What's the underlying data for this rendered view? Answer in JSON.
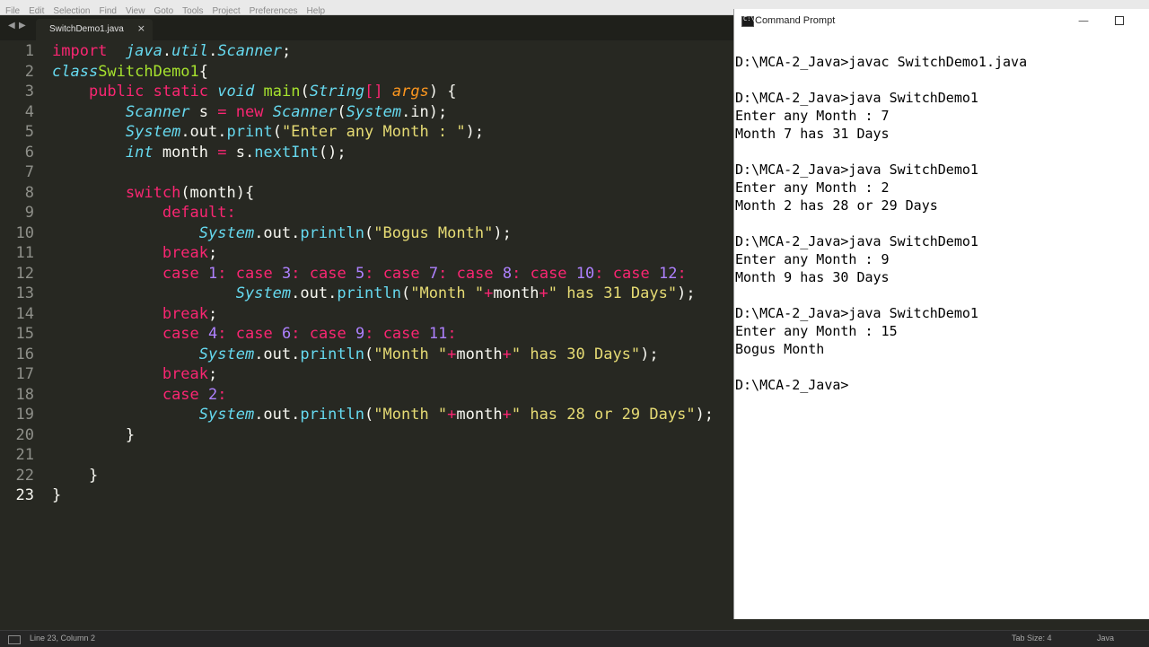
{
  "menu": [
    "File",
    "Edit",
    "Selection",
    "Find",
    "View",
    "Goto",
    "Tools",
    "Project",
    "Preferences",
    "Help"
  ],
  "tab": {
    "title": "SwitchDemo1.java",
    "close": "×"
  },
  "nav": {
    "back": "◀",
    "forward": "▶"
  },
  "editor": {
    "line_numbers": [
      "1",
      "2",
      "3",
      "4",
      "5",
      "6",
      "7",
      "8",
      "9",
      "10",
      "11",
      "12",
      "13",
      "14",
      "15",
      "16",
      "17",
      "18",
      "19",
      "20",
      "21",
      "22",
      "23"
    ],
    "current_line": "23",
    "lines": [
      {
        "n": "1",
        "tokens": [
          [
            "kw",
            "import"
          ],
          [
            "",
            "  "
          ],
          [
            "ty",
            "java"
          ],
          [
            "",
            "."
          ],
          [
            "ty",
            "util"
          ],
          [
            "",
            "."
          ],
          [
            "ty",
            "Scanner"
          ],
          [
            "",
            ";"
          ]
        ]
      },
      {
        "n": "2",
        "tokens": [
          [
            "ty",
            "class"
          ],
          [
            "",
            ""
          ],
          [
            "fn",
            "SwitchDemo1"
          ],
          [
            "",
            "{"
          ]
        ]
      },
      {
        "n": "3",
        "tokens": [
          [
            "",
            "    "
          ],
          [
            "kw",
            "public"
          ],
          [
            "",
            " "
          ],
          [
            "kw",
            "static"
          ],
          [
            "",
            " "
          ],
          [
            "ty",
            "void"
          ],
          [
            "",
            " "
          ],
          [
            "fn",
            "main"
          ],
          [
            "",
            "("
          ],
          [
            "ty",
            "String"
          ],
          [
            "kw",
            "[]"
          ],
          [
            "",
            " "
          ],
          [
            "ar",
            "args"
          ],
          [
            "",
            ") {"
          ]
        ]
      },
      {
        "n": "4",
        "tokens": [
          [
            "",
            "        "
          ],
          [
            "ty",
            "Scanner"
          ],
          [
            "",
            " s "
          ],
          [
            "kw",
            "="
          ],
          [
            "",
            " "
          ],
          [
            "kw",
            "new"
          ],
          [
            "",
            " "
          ],
          [
            "ty",
            "Scanner"
          ],
          [
            "",
            "("
          ],
          [
            "ty",
            "System"
          ],
          [
            "",
            ".in);"
          ]
        ]
      },
      {
        "n": "5",
        "tokens": [
          [
            "",
            "        "
          ],
          [
            "ty",
            "System"
          ],
          [
            "",
            ".out."
          ],
          [
            "cn",
            "print"
          ],
          [
            "",
            "("
          ],
          [
            "st",
            "\"Enter any Month : \""
          ],
          [
            "",
            ");"
          ]
        ]
      },
      {
        "n": "6",
        "tokens": [
          [
            "",
            "        "
          ],
          [
            "ty",
            "int"
          ],
          [
            "",
            " month "
          ],
          [
            "kw",
            "="
          ],
          [
            "",
            " s."
          ],
          [
            "cn",
            "nextInt"
          ],
          [
            "",
            "();"
          ]
        ]
      },
      {
        "n": "7",
        "tokens": []
      },
      {
        "n": "8",
        "tokens": [
          [
            "",
            "        "
          ],
          [
            "kw",
            "switch"
          ],
          [
            "",
            "(month){"
          ]
        ]
      },
      {
        "n": "9",
        "tokens": [
          [
            "",
            "            "
          ],
          [
            "kw",
            "default:"
          ]
        ]
      },
      {
        "n": "10",
        "tokens": [
          [
            "",
            "                "
          ],
          [
            "ty",
            "System"
          ],
          [
            "",
            ".out."
          ],
          [
            "cn",
            "println"
          ],
          [
            "",
            "("
          ],
          [
            "st",
            "\"Bogus Month\""
          ],
          [
            "",
            ");"
          ]
        ]
      },
      {
        "n": "11",
        "tokens": [
          [
            "",
            "            "
          ],
          [
            "kw",
            "break"
          ],
          [
            "",
            ";"
          ]
        ]
      },
      {
        "n": "12",
        "tokens": [
          [
            "",
            "            "
          ],
          [
            "kw",
            "case"
          ],
          [
            "",
            " "
          ],
          [
            "nu",
            "1"
          ],
          [
            "kw",
            ":"
          ],
          [
            "",
            " "
          ],
          [
            "kw",
            "case"
          ],
          [
            "",
            " "
          ],
          [
            "nu",
            "3"
          ],
          [
            "kw",
            ":"
          ],
          [
            "",
            " "
          ],
          [
            "kw",
            "case"
          ],
          [
            "",
            " "
          ],
          [
            "nu",
            "5"
          ],
          [
            "kw",
            ":"
          ],
          [
            "",
            " "
          ],
          [
            "kw",
            "case"
          ],
          [
            "",
            " "
          ],
          [
            "nu",
            "7"
          ],
          [
            "kw",
            ":"
          ],
          [
            "",
            " "
          ],
          [
            "kw",
            "case"
          ],
          [
            "",
            " "
          ],
          [
            "nu",
            "8"
          ],
          [
            "kw",
            ":"
          ],
          [
            "",
            " "
          ],
          [
            "kw",
            "case"
          ],
          [
            "",
            " "
          ],
          [
            "nu",
            "10"
          ],
          [
            "kw",
            ":"
          ],
          [
            "",
            " "
          ],
          [
            "kw",
            "case"
          ],
          [
            "",
            " "
          ],
          [
            "nu",
            "12"
          ],
          [
            "kw",
            ":"
          ]
        ]
      },
      {
        "n": "13",
        "tokens": [
          [
            "",
            "                    "
          ],
          [
            "ty",
            "System"
          ],
          [
            "",
            ".out."
          ],
          [
            "cn",
            "println"
          ],
          [
            "",
            "("
          ],
          [
            "st",
            "\"Month \""
          ],
          [
            "kw",
            "+"
          ],
          [
            "",
            "month"
          ],
          [
            "kw",
            "+"
          ],
          [
            "st",
            "\" has 31 Days\""
          ],
          [
            "",
            ");"
          ]
        ]
      },
      {
        "n": "14",
        "tokens": [
          [
            "",
            "            "
          ],
          [
            "kw",
            "break"
          ],
          [
            "",
            ";"
          ]
        ]
      },
      {
        "n": "15",
        "tokens": [
          [
            "",
            "            "
          ],
          [
            "kw",
            "case"
          ],
          [
            "",
            " "
          ],
          [
            "nu",
            "4"
          ],
          [
            "kw",
            ":"
          ],
          [
            "",
            " "
          ],
          [
            "kw",
            "case"
          ],
          [
            "",
            " "
          ],
          [
            "nu",
            "6"
          ],
          [
            "kw",
            ":"
          ],
          [
            "",
            " "
          ],
          [
            "kw",
            "case"
          ],
          [
            "",
            " "
          ],
          [
            "nu",
            "9"
          ],
          [
            "kw",
            ":"
          ],
          [
            "",
            " "
          ],
          [
            "kw",
            "case"
          ],
          [
            "",
            " "
          ],
          [
            "nu",
            "11"
          ],
          [
            "kw",
            ":"
          ]
        ]
      },
      {
        "n": "16",
        "tokens": [
          [
            "",
            "                "
          ],
          [
            "ty",
            "System"
          ],
          [
            "",
            ".out."
          ],
          [
            "cn",
            "println"
          ],
          [
            "",
            "("
          ],
          [
            "st",
            "\"Month \""
          ],
          [
            "kw",
            "+"
          ],
          [
            "",
            "month"
          ],
          [
            "kw",
            "+"
          ],
          [
            "st",
            "\" has 30 Days\""
          ],
          [
            "",
            ");"
          ]
        ]
      },
      {
        "n": "17",
        "tokens": [
          [
            "",
            "            "
          ],
          [
            "kw",
            "break"
          ],
          [
            "",
            ";"
          ]
        ]
      },
      {
        "n": "18",
        "tokens": [
          [
            "",
            "            "
          ],
          [
            "kw",
            "case"
          ],
          [
            "",
            " "
          ],
          [
            "nu",
            "2"
          ],
          [
            "kw",
            ":"
          ]
        ]
      },
      {
        "n": "19",
        "tokens": [
          [
            "",
            "                "
          ],
          [
            "ty",
            "System"
          ],
          [
            "",
            ".out."
          ],
          [
            "cn",
            "println"
          ],
          [
            "",
            "("
          ],
          [
            "st",
            "\"Month \""
          ],
          [
            "kw",
            "+"
          ],
          [
            "",
            "month"
          ],
          [
            "kw",
            "+"
          ],
          [
            "st",
            "\" has 28 or 29 Days\""
          ],
          [
            "",
            ");"
          ]
        ]
      },
      {
        "n": "20",
        "tokens": [
          [
            "",
            "        }"
          ]
        ]
      },
      {
        "n": "21",
        "tokens": []
      },
      {
        "n": "22",
        "tokens": [
          [
            "",
            "    }"
          ]
        ]
      },
      {
        "n": "23",
        "tokens": [
          [
            "",
            "}"
          ]
        ]
      }
    ]
  },
  "statusbar": {
    "position": "Line 23, Column 2",
    "tab_size": "Tab Size: 4",
    "syntax": "Java"
  },
  "cmd": {
    "title": "Command Prompt",
    "icon_glyph": "C:\\",
    "minimize": "—",
    "lines": [
      "",
      "D:\\MCA-2_Java>javac SwitchDemo1.java",
      "",
      "D:\\MCA-2_Java>java SwitchDemo1",
      "Enter any Month : 7",
      "Month 7 has 31 Days",
      "",
      "D:\\MCA-2_Java>java SwitchDemo1",
      "Enter any Month : 2",
      "Month 2 has 28 or 29 Days",
      "",
      "D:\\MCA-2_Java>java SwitchDemo1",
      "Enter any Month : 9",
      "Month 9 has 30 Days",
      "",
      "D:\\MCA-2_Java>java SwitchDemo1",
      "Enter any Month : 15",
      "Bogus Month",
      "",
      "D:\\MCA-2_Java>"
    ]
  },
  "colors": {
    "editor_bg": "#272822",
    "keyword": "#f92672",
    "type": "#66d9ef",
    "function": "#a6e22e",
    "string": "#e6db74",
    "number": "#ae81ff",
    "argument": "#fd971f"
  }
}
